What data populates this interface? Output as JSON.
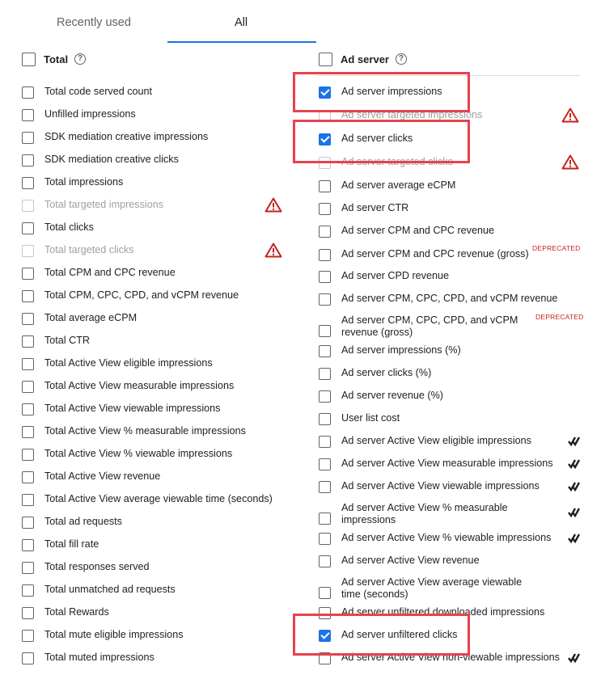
{
  "tabs": [
    {
      "label": "Recently used"
    },
    {
      "label": "All"
    }
  ],
  "left": {
    "header": "Total",
    "items": [
      {
        "label": "Total code served count",
        "checked": false,
        "disabled": false
      },
      {
        "label": "Unfilled impressions",
        "checked": false,
        "disabled": false
      },
      {
        "label": "SDK mediation creative impressions",
        "checked": false,
        "disabled": false
      },
      {
        "label": "SDK mediation creative clicks",
        "checked": false,
        "disabled": false
      },
      {
        "label": "Total impressions",
        "checked": false,
        "disabled": false
      },
      {
        "label": "Total targeted impressions",
        "checked": false,
        "disabled": true,
        "warning": true
      },
      {
        "label": "Total clicks",
        "checked": false,
        "disabled": false
      },
      {
        "label": "Total targeted clicks",
        "checked": false,
        "disabled": true,
        "warning": true
      },
      {
        "label": "Total CPM and CPC revenue",
        "checked": false,
        "disabled": false
      },
      {
        "label": "Total CPM, CPC, CPD, and vCPM revenue",
        "checked": false,
        "disabled": false
      },
      {
        "label": "Total average eCPM",
        "checked": false,
        "disabled": false
      },
      {
        "label": "Total CTR",
        "checked": false,
        "disabled": false
      },
      {
        "label": "Total Active View eligible impressions",
        "checked": false,
        "disabled": false
      },
      {
        "label": "Total Active View measurable impressions",
        "checked": false,
        "disabled": false
      },
      {
        "label": "Total Active View viewable impressions",
        "checked": false,
        "disabled": false
      },
      {
        "label": "Total Active View % measurable impressions",
        "checked": false,
        "disabled": false
      },
      {
        "label": "Total Active View % viewable impressions",
        "checked": false,
        "disabled": false
      },
      {
        "label": "Total Active View revenue",
        "checked": false,
        "disabled": false
      },
      {
        "label": "Total Active View average viewable time (seconds)",
        "checked": false,
        "disabled": false
      },
      {
        "label": "Total ad requests",
        "checked": false,
        "disabled": false
      },
      {
        "label": "Total fill rate",
        "checked": false,
        "disabled": false
      },
      {
        "label": "Total responses served",
        "checked": false,
        "disabled": false
      },
      {
        "label": "Total unmatched ad requests",
        "checked": false,
        "disabled": false
      },
      {
        "label": "Total Rewards",
        "checked": false,
        "disabled": false
      },
      {
        "label": "Total mute eligible impressions",
        "checked": false,
        "disabled": false
      },
      {
        "label": "Total muted impressions",
        "checked": false,
        "disabled": false
      }
    ]
  },
  "right": {
    "header": "Ad server",
    "items": [
      {
        "label": "Ad server impressions",
        "checked": true,
        "disabled": false,
        "highlight": true
      },
      {
        "label": "Ad server targeted impressions",
        "checked": false,
        "disabled": true,
        "warning": true
      },
      {
        "label": "Ad server clicks",
        "checked": true,
        "disabled": false,
        "highlight": true
      },
      {
        "label": "Ad server targeted clicks",
        "checked": false,
        "disabled": true,
        "warning": true
      },
      {
        "label": "Ad server average eCPM",
        "checked": false,
        "disabled": false
      },
      {
        "label": "Ad server CTR",
        "checked": false,
        "disabled": false
      },
      {
        "label": "Ad server CPM and CPC revenue",
        "checked": false,
        "disabled": false
      },
      {
        "label": "Ad server CPM and CPC revenue (gross)",
        "checked": false,
        "disabled": false,
        "deprecated": "DEPRECATED"
      },
      {
        "label": "Ad server CPD revenue",
        "checked": false,
        "disabled": false
      },
      {
        "label": "Ad server CPM, CPC, CPD, and vCPM revenue",
        "checked": false,
        "disabled": false
      },
      {
        "label": "Ad server CPM, CPC, CPD, and vCPM revenue (gross)",
        "checked": false,
        "disabled": false,
        "deprecated": "DEPRECATED",
        "wrap": true
      },
      {
        "label": "Ad server impressions (%)",
        "checked": false,
        "disabled": false
      },
      {
        "label": "Ad server clicks (%)",
        "checked": false,
        "disabled": false
      },
      {
        "label": "Ad server revenue (%)",
        "checked": false,
        "disabled": false
      },
      {
        "label": "User list cost",
        "checked": false,
        "disabled": false
      },
      {
        "label": "Ad server Active View eligible impressions",
        "checked": false,
        "disabled": false,
        "activeview": true
      },
      {
        "label": "Ad server Active View measurable impressions",
        "checked": false,
        "disabled": false,
        "activeview": true
      },
      {
        "label": "Ad server Active View viewable impressions",
        "checked": false,
        "disabled": false,
        "activeview": true
      },
      {
        "label": "Ad server Active View % measurable impressions",
        "checked": false,
        "disabled": false,
        "activeview": true,
        "wrap": true
      },
      {
        "label": "Ad server Active View % viewable impressions",
        "checked": false,
        "disabled": false,
        "activeview": true
      },
      {
        "label": "Ad server Active View revenue",
        "checked": false,
        "disabled": false
      },
      {
        "label": "Ad server Active View average viewable time (seconds)",
        "checked": false,
        "disabled": false,
        "wrap": true
      },
      {
        "label": "Ad server unfiltered downloaded impressions",
        "checked": false,
        "disabled": false
      },
      {
        "label": "Ad server unfiltered clicks",
        "checked": true,
        "disabled": false,
        "highlight": true
      },
      {
        "label": "Ad server Active View non-viewable impressions",
        "checked": false,
        "disabled": false,
        "activeview": true
      }
    ]
  },
  "colors": {
    "accent": "#1a73e8",
    "highlight": "#e8414e",
    "warning": "#c5221f",
    "deprecated": "#c5221f"
  }
}
